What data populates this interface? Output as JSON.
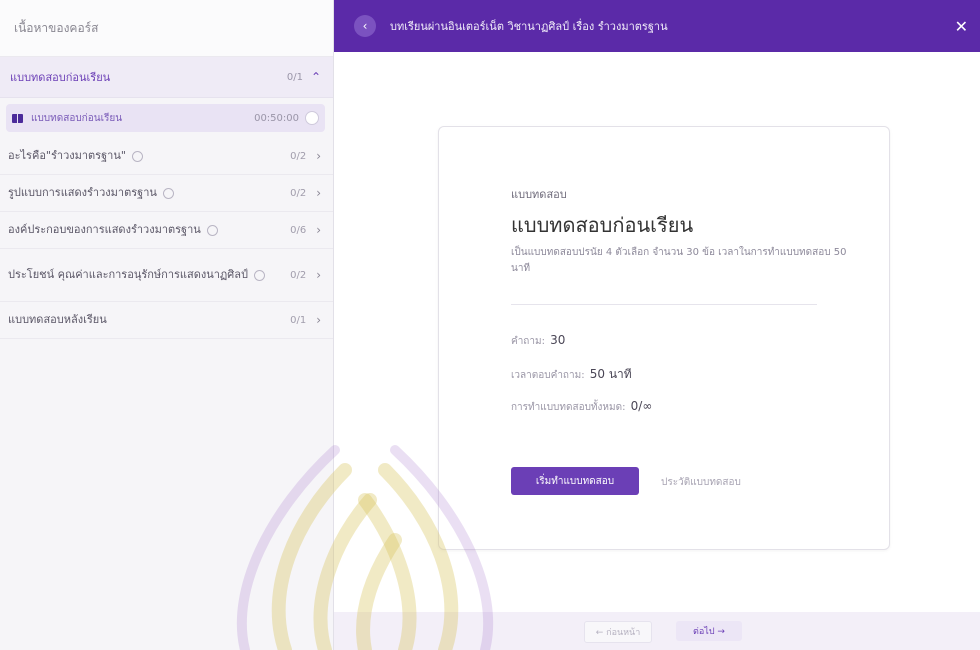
{
  "sidebar": {
    "header": "เนื้อหาของคอร์ส",
    "section": {
      "label": "แบบทดสอบก่อนเรียน",
      "count": "0/1"
    },
    "lesson": {
      "label": "แบบทดสอบก่อนเรียน",
      "time": "00:50:00"
    },
    "items": [
      {
        "label": "อะไรคือ\"รำวงมาตรฐาน\"",
        "count": "0/2"
      },
      {
        "label": "รูปแบบการแสดงรำวงมาตรฐาน",
        "count": "0/2"
      },
      {
        "label": "องค์ประกอบของการแสดงรำวงมาตรฐาน",
        "count": "0/6"
      },
      {
        "label": "ประโยชน์ คุณค่าและการอนุรักษ์การแสดงนาฏศิลป์",
        "count": "0/2"
      },
      {
        "label": "แบบทดสอบหลังเรียน",
        "count": "0/1"
      }
    ]
  },
  "topbar": {
    "title": "บทเรียนผ่านอินเตอร์เน็ต วิชานาฏศิลป์ เรื่อง รำวงมาตรฐาน"
  },
  "card": {
    "kicker": "แบบทดสอบ",
    "heading": "แบบทดสอบก่อนเรียน",
    "description": "เป็นแบบทดสอบปรนัย 4 ตัวเลือก จำนวน 30 ข้อ เวลาในการทำแบบทดสอบ 50 นาที",
    "questions_label": "คำถาม:",
    "questions_value": "30",
    "time_label": "เวลาตอบคำถาม:",
    "time_value": "50 นาที",
    "attempts_label": "การทำแบบทดสอบทั้งหมด:",
    "attempts_value": "0/∞",
    "start_button": "เริ่มทำแบบทดสอบ",
    "history_link": "ประวัติแบบทดสอบ"
  },
  "bottombar": {
    "prev_label": "← ก่อนหน้า",
    "next_label": "ต่อไป →"
  },
  "colors": {
    "brand": "#5b2aa8",
    "accent": "#6b3fb6",
    "sidebar_bg": "#f6f5f8"
  }
}
